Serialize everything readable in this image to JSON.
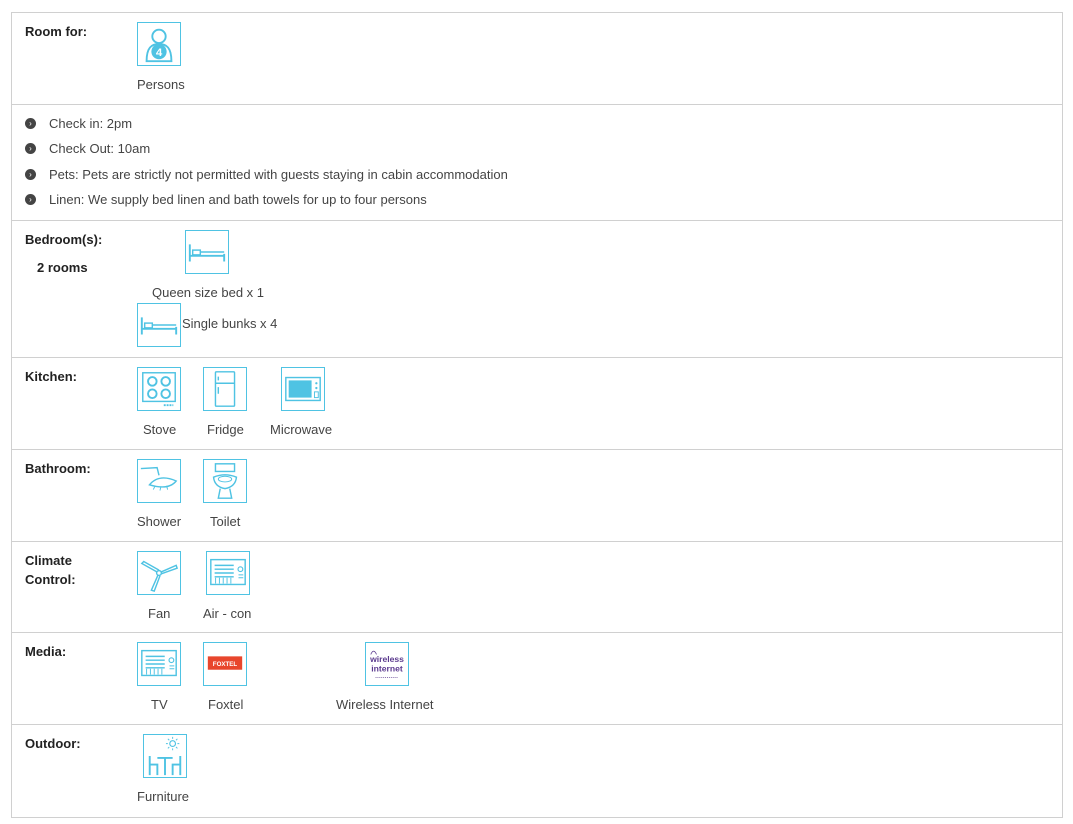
{
  "accent_color": "#4fc3e3",
  "room_for": {
    "label": "Room for:",
    "count": "4",
    "caption": "Persons",
    "icon": "person-icon"
  },
  "info": [
    "Check in: 2pm",
    "Check Out: 10am",
    "Pets: Pets are strictly not permitted with guests staying in cabin accommodation",
    "Linen: We supply bed linen and bath towels for up to four persons"
  ],
  "bedrooms": {
    "label": "Bedroom(s):",
    "rooms": "2 rooms",
    "items": [
      {
        "caption": "Queen size bed x 1",
        "icon": "bed-icon"
      },
      {
        "caption": "Single bunks x 4",
        "icon": "bed-icon"
      }
    ]
  },
  "kitchen": {
    "label": "Kitchen:",
    "items": [
      {
        "caption": "Stove",
        "icon": "stove-icon"
      },
      {
        "caption": "Fridge",
        "icon": "fridge-icon"
      },
      {
        "caption": "Microwave",
        "icon": "microwave-icon"
      }
    ]
  },
  "bathroom": {
    "label": "Bathroom:",
    "items": [
      {
        "caption": "Shower",
        "icon": "shower-icon"
      },
      {
        "caption": "Toilet",
        "icon": "toilet-icon"
      }
    ]
  },
  "climate": {
    "label_line1": "Climate",
    "label_line2": "Control:",
    "items": [
      {
        "caption": "Fan",
        "icon": "fan-icon"
      },
      {
        "caption": "Air - con",
        "icon": "aircon-icon"
      }
    ]
  },
  "media": {
    "label": "Media:",
    "items": [
      {
        "caption": "TV",
        "icon": "tv-icon"
      },
      {
        "caption": "Foxtel",
        "icon": "foxtel-logo",
        "logo_text": "FOXTEL"
      },
      {
        "caption": "Wireless Internet",
        "icon": "wireless-internet-logo",
        "logo_line1": "wireless",
        "logo_line2": "internet"
      }
    ]
  },
  "outdoor": {
    "label": "Outdoor:",
    "items": [
      {
        "caption": "Furniture",
        "icon": "outdoor-furniture-icon"
      }
    ]
  }
}
